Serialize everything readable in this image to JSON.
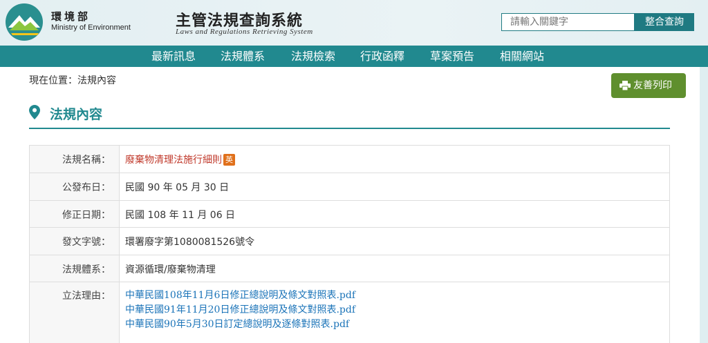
{
  "header": {
    "ministry_cn": "環境部",
    "ministry_en": "Ministry of Environment",
    "site_title_cn": "主管法規查詢系統",
    "site_title_en": "Laws and Regulations Retrieving System",
    "search_placeholder": "請輸入關鍵字",
    "search_button": "整合查詢"
  },
  "nav": {
    "items": [
      {
        "label": "最新訊息"
      },
      {
        "label": "法規體系"
      },
      {
        "label": "法規檢索"
      },
      {
        "label": "行政函釋"
      },
      {
        "label": "草案預告"
      },
      {
        "label": "相關網站"
      }
    ]
  },
  "breadcrumb": "現在位置：法規內容",
  "print_button": "友善列印",
  "page_title": "法規內容",
  "table": {
    "rows": [
      {
        "label": "法規名稱：",
        "value": "廢棄物清理法施行細則",
        "badge": "英"
      },
      {
        "label": "公發布日：",
        "value": "民國 90 年 05 月 30 日"
      },
      {
        "label": "修正日期：",
        "value": "民國 108 年 11 月 06 日"
      },
      {
        "label": "發文字號：",
        "value": "環署廢字第1080081526號令"
      },
      {
        "label": "法規體系：",
        "value": "資源循環/廢棄物清理"
      },
      {
        "label": "立法理由：",
        "links": [
          "中華民國108年11月6日修正總說明及條文對照表.pdf",
          "中華民國91年11月20日修正總說明及條文對照表.pdf",
          "中華民國90年5月30日訂定總說明及逐條對照表.pdf"
        ]
      }
    ]
  },
  "colors": {
    "primary_teal": "#21898f",
    "print_green": "#5f8f2e",
    "law_name_red": "#c0392b",
    "badge_orange": "#e0701b",
    "link_blue": "#1a73b8"
  }
}
